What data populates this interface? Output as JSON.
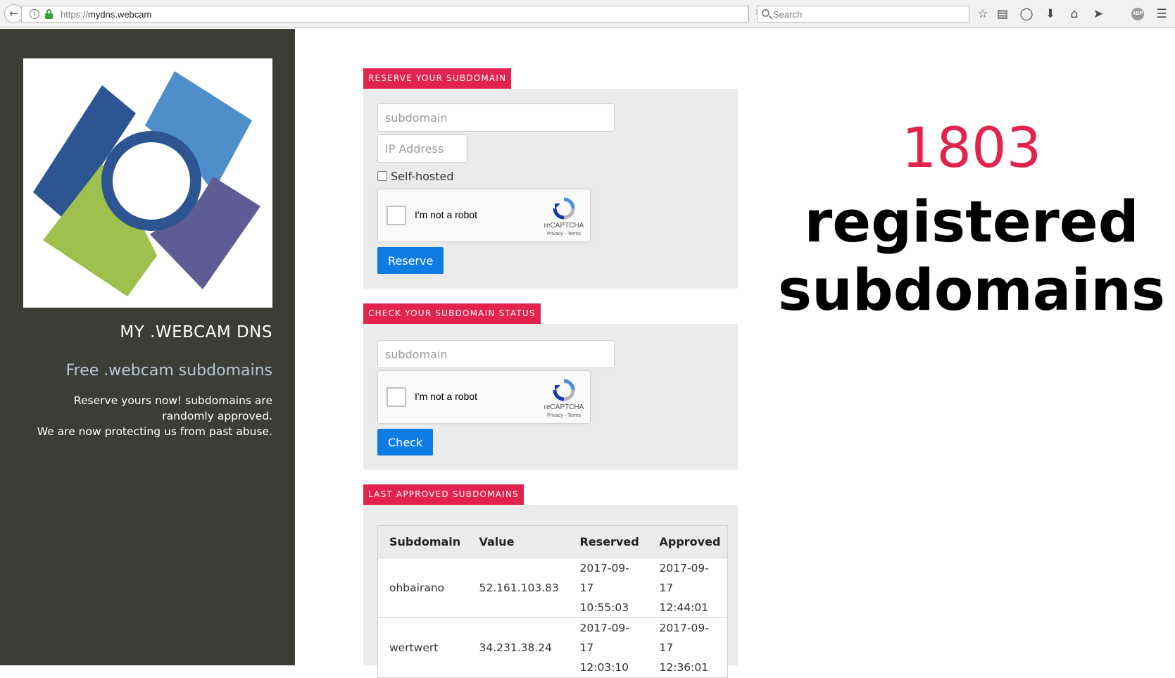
{
  "browser": {
    "url_scheme": "https://",
    "url_host": "mydns.webcam",
    "search_placeholder": "Search",
    "toolbar_icons": [
      "star-icon",
      "reading-list-icon",
      "pocket-icon",
      "download-icon",
      "home-icon",
      "send-icon",
      "adblock-icon",
      "menu-icon"
    ],
    "abp_label": "ABP"
  },
  "sidebar": {
    "title": "MY .WEBCAM DNS",
    "tagline": "Free .webcam subdomains",
    "description_line1": "Reserve yours now! subdomains are randomly approved.",
    "description_line2": "We are now protecting us from past abuse."
  },
  "reserve": {
    "heading": "RESERVE YOUR SUBDOMAIN",
    "subdomain_placeholder": "subdomain",
    "ip_placeholder": "IP Address",
    "self_hosted_label": "Self-hosted",
    "captcha_label": "I'm not a robot",
    "captcha_brand": "reCAPTCHA",
    "captcha_terms": "Privacy - Terms",
    "button_label": "Reserve"
  },
  "check": {
    "heading": "CHECK YOUR SUBDOMAIN STATUS",
    "subdomain_placeholder": "subdomain",
    "captcha_label": "I'm not a robot",
    "captcha_brand": "reCAPTCHA",
    "captcha_terms": "Privacy - Terms",
    "button_label": "Check"
  },
  "approved": {
    "heading": "LAST APPROVED SUBDOMAINS",
    "columns": [
      "Subdomain",
      "Value",
      "Reserved",
      "Approved"
    ],
    "rows": [
      {
        "subdomain": "ohbairano",
        "value": "52.161.103.83",
        "reserved_date": "2017-09-17",
        "reserved_time": "10:55:03",
        "approved_date": "2017-09-17",
        "approved_time": "12:44:01"
      },
      {
        "subdomain": "wertwert",
        "value": "34.231.38.24",
        "reserved_date": "2017-09-17",
        "reserved_time": "12:03:10",
        "approved_date": "2017-09-17",
        "approved_time": "12:36:01"
      }
    ]
  },
  "counter": {
    "count": "1803",
    "label_line1": "registered",
    "label_line2": "subdomains"
  },
  "colors": {
    "accent": "#e2234e",
    "sidebar_bg": "#3d3d37",
    "button": "#0d7de4",
    "panel_bg": "#ebebeb"
  }
}
